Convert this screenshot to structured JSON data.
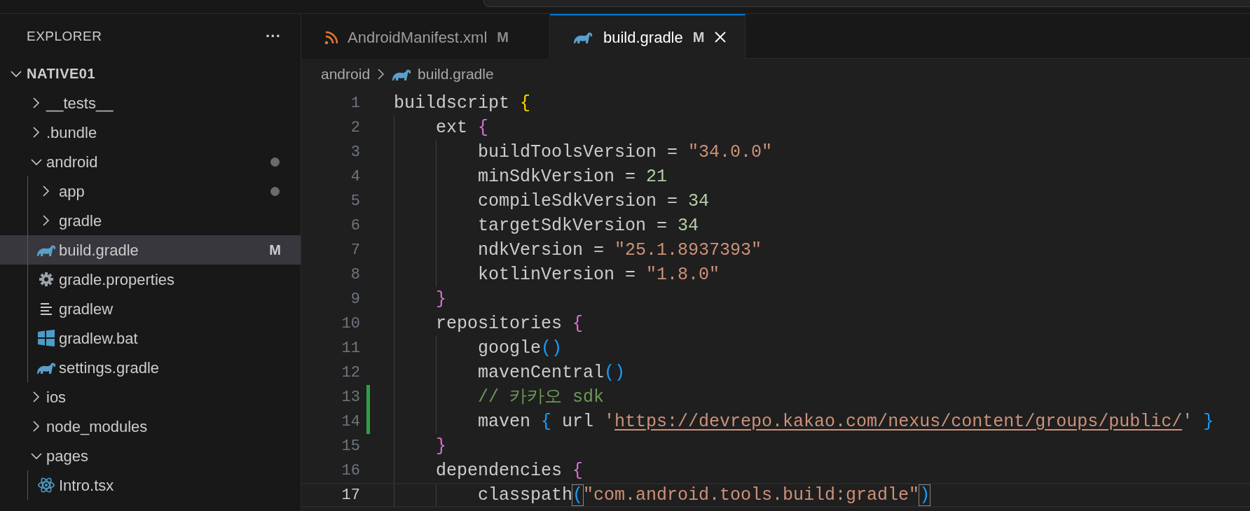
{
  "sidebar": {
    "title": "EXPLORER",
    "more": "···",
    "tree": [
      {
        "label": "NATIVE01",
        "kind": "root",
        "expanded": true,
        "has_changes": false,
        "selected": false,
        "children": [
          {
            "label": "__tests__",
            "kind": "folder",
            "expanded": false,
            "has_changes": false,
            "selected": false
          },
          {
            "label": ".bundle",
            "kind": "folder",
            "expanded": false,
            "has_changes": false,
            "selected": false
          },
          {
            "label": "android",
            "kind": "folder",
            "expanded": true,
            "has_changes": true,
            "selected": false,
            "children": [
              {
                "label": "app",
                "kind": "folder",
                "expanded": false,
                "has_changes": true,
                "selected": false
              },
              {
                "label": "gradle",
                "kind": "folder",
                "expanded": false,
                "has_changes": false,
                "selected": false
              },
              {
                "label": "build.gradle",
                "kind": "gradle_file",
                "badge": "M",
                "has_changes": false,
                "selected": true
              },
              {
                "label": "gradle.properties",
                "kind": "properties_file",
                "has_changes": false,
                "selected": false
              },
              {
                "label": "gradlew",
                "kind": "text_file",
                "has_changes": false,
                "selected": false
              },
              {
                "label": "gradlew.bat",
                "kind": "batch_file",
                "has_changes": false,
                "selected": false
              },
              {
                "label": "settings.gradle",
                "kind": "gradle_file",
                "has_changes": false,
                "selected": false
              }
            ]
          },
          {
            "label": "ios",
            "kind": "folder",
            "expanded": false,
            "has_changes": false,
            "selected": false
          },
          {
            "label": "node_modules",
            "kind": "folder",
            "expanded": false,
            "has_changes": false,
            "selected": false
          },
          {
            "label": "pages",
            "kind": "folder",
            "expanded": true,
            "has_changes": false,
            "selected": false,
            "children": [
              {
                "label": "Intro.tsx",
                "kind": "react_file",
                "has_changes": false,
                "selected": false
              }
            ]
          }
        ]
      }
    ]
  },
  "tabs": [
    {
      "label": "AndroidManifest.xml",
      "kind": "xml_file",
      "badge": "M",
      "selected": false
    },
    {
      "label": "build.gradle",
      "kind": "gradle_file",
      "badge": "M",
      "selected": true
    }
  ],
  "breadcrumb": [
    {
      "label": "android",
      "kind": "folder"
    },
    {
      "label": "build.gradle",
      "kind": "gradle_file"
    }
  ],
  "code_lines": [
    {
      "number": "1",
      "changed": false,
      "current": false,
      "tokens": [
        {
          "kind": "plain",
          "text": "buildscript "
        },
        {
          "kind": "brace1",
          "text": "{"
        }
      ]
    },
    {
      "number": "2",
      "changed": false,
      "current": false,
      "tokens": [
        {
          "kind": "plain",
          "text": "ext "
        },
        {
          "kind": "brace2",
          "text": "{"
        }
      ]
    },
    {
      "number": "3",
      "changed": false,
      "current": false,
      "tokens": [
        {
          "kind": "plain",
          "text": "buildToolsVersion = "
        },
        {
          "kind": "string",
          "text": "\"34.0.0\""
        }
      ]
    },
    {
      "number": "4",
      "changed": false,
      "current": false,
      "tokens": [
        {
          "kind": "plain",
          "text": "minSdkVersion = "
        },
        {
          "kind": "number",
          "text": "21"
        }
      ]
    },
    {
      "number": "5",
      "changed": false,
      "current": false,
      "tokens": [
        {
          "kind": "plain",
          "text": "compileSdkVersion = "
        },
        {
          "kind": "number",
          "text": "34"
        }
      ]
    },
    {
      "number": "6",
      "changed": false,
      "current": false,
      "tokens": [
        {
          "kind": "plain",
          "text": "targetSdkVersion = "
        },
        {
          "kind": "number",
          "text": "34"
        }
      ]
    },
    {
      "number": "7",
      "changed": false,
      "current": false,
      "tokens": [
        {
          "kind": "plain",
          "text": "ndkVersion = "
        },
        {
          "kind": "string",
          "text": "\"25.1.8937393\""
        }
      ]
    },
    {
      "number": "8",
      "changed": false,
      "current": false,
      "tokens": [
        {
          "kind": "plain",
          "text": "kotlinVersion = "
        },
        {
          "kind": "string",
          "text": "\"1.8.0\""
        }
      ]
    },
    {
      "number": "9",
      "changed": false,
      "current": false,
      "tokens": [
        {
          "kind": "brace2",
          "text": "}"
        }
      ]
    },
    {
      "number": "10",
      "changed": false,
      "current": false,
      "tokens": [
        {
          "kind": "plain",
          "text": "repositories "
        },
        {
          "kind": "brace2",
          "text": "{"
        }
      ]
    },
    {
      "number": "11",
      "changed": false,
      "current": false,
      "tokens": [
        {
          "kind": "plain",
          "text": "google"
        },
        {
          "kind": "brace3",
          "text": "()"
        }
      ]
    },
    {
      "number": "12",
      "changed": false,
      "current": false,
      "tokens": [
        {
          "kind": "plain",
          "text": "mavenCentral"
        },
        {
          "kind": "brace3",
          "text": "()"
        }
      ]
    },
    {
      "number": "13",
      "changed": true,
      "current": false,
      "tokens": [
        {
          "kind": "comment",
          "text": "// 카카오 sdk"
        }
      ]
    },
    {
      "number": "14",
      "changed": true,
      "current": false,
      "tokens": [
        {
          "kind": "plain",
          "text": "maven "
        },
        {
          "kind": "brace3",
          "text": "{"
        },
        {
          "kind": "plain",
          "text": " url "
        },
        {
          "kind": "string",
          "text": "'"
        },
        {
          "kind": "link",
          "text": "https://devrepo.kakao.com/nexus/content/groups/public/"
        },
        {
          "kind": "string",
          "text": "' "
        },
        {
          "kind": "brace3",
          "text": "}"
        }
      ]
    },
    {
      "number": "15",
      "changed": false,
      "current": false,
      "tokens": [
        {
          "kind": "brace2",
          "text": "}"
        }
      ]
    },
    {
      "number": "16",
      "changed": false,
      "current": false,
      "tokens": [
        {
          "kind": "plain",
          "text": "dependencies "
        },
        {
          "kind": "brace2",
          "text": "{"
        }
      ]
    },
    {
      "number": "17",
      "changed": false,
      "current": true,
      "tokens": [
        {
          "kind": "plain",
          "text": "classpath"
        },
        {
          "kind": "match",
          "text": "("
        },
        {
          "kind": "string",
          "text": "\"com.android.tools.build:gradle\""
        },
        {
          "kind": "match",
          "text": ")"
        }
      ]
    }
  ]
}
